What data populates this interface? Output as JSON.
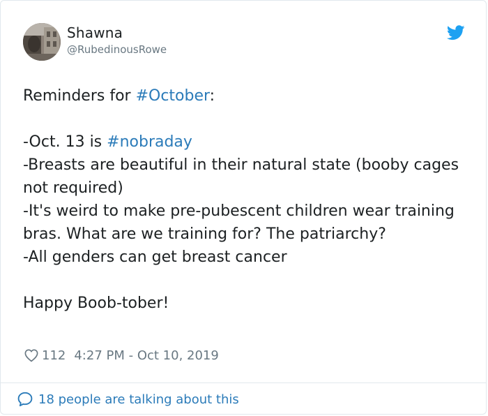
{
  "user": {
    "display_name": "Shawna",
    "handle": "@RubedinousRowe"
  },
  "icons": {
    "brand": "twitter-bird-icon",
    "like": "heart-icon",
    "reply": "speech-bubble-icon"
  },
  "colors": {
    "hashtag": "#2b7bb9",
    "secondary_text": "#697882",
    "brand": "#1da1f2"
  },
  "tweet": {
    "intro": "Reminders for ",
    "hashtag_october": "#October",
    "intro_end": ":",
    "line1_prefix": "-Oct. 13 is ",
    "hashtag_nobraday": "#nobraday",
    "line2": "-Breasts are beautiful in their natural state (booby cages not required)",
    "line3": "-It's weird to make pre-pubescent children wear training bras. What are we training for? The patriarchy?",
    "line4": "-All genders can get breast cancer",
    "closing": "Happy Boob-tober!"
  },
  "meta": {
    "like_count": "112",
    "timestamp": "4:27 PM - Oct 10, 2019"
  },
  "footer": {
    "conversation_link": "18 people are talking about this"
  }
}
